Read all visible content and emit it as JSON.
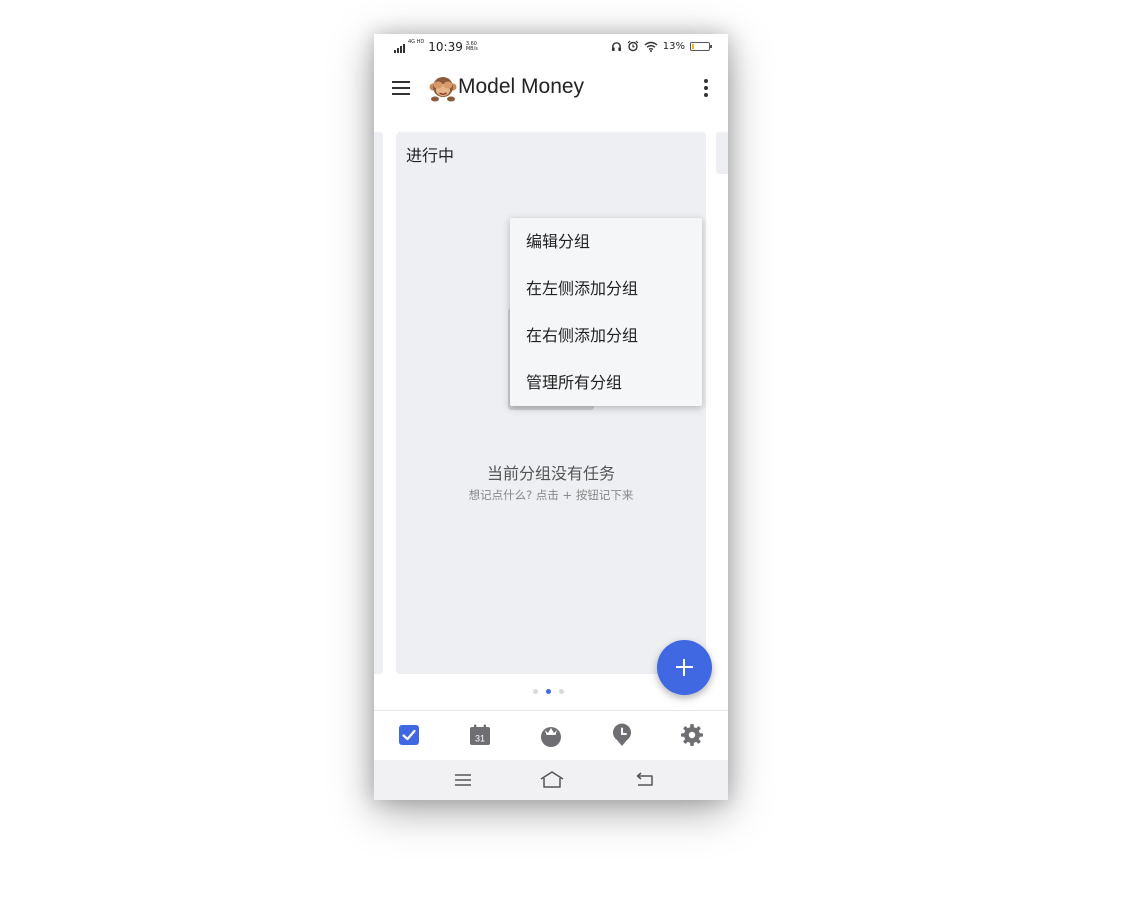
{
  "status_bar": {
    "network": "4G HD",
    "time": "10:39",
    "speed": "3.60 MB/s",
    "battery": "13%",
    "battery_level": 0.13,
    "battery_color": "#f2b418"
  },
  "app_bar": {
    "title": "Model Money",
    "logo_icon": "monkey-see-no-evil-icon",
    "menu_icon": "hamburger-icon",
    "more_icon": "more-vert-icon"
  },
  "group": {
    "title": "进行中",
    "empty_title": "当前分组没有任务",
    "empty_subtitle": "想记点什么? 点击 + 按钮记下来",
    "illustration_icon": "clipboard-pencil-icon"
  },
  "dropdown_menu": {
    "items": [
      "编辑分组",
      "在左侧添加分组",
      "在右侧添加分组",
      "管理所有分组"
    ]
  },
  "fab": {
    "icon": "plus-icon",
    "color": "#4168e3"
  },
  "pager": {
    "count": 3,
    "active_index": 1
  },
  "bottom_nav": {
    "items": [
      {
        "icon": "checkbox-icon",
        "active": true
      },
      {
        "icon": "calendar-icon",
        "label": "31",
        "active": false
      },
      {
        "icon": "tomato-icon",
        "active": false
      },
      {
        "icon": "clock-pin-icon",
        "active": false
      },
      {
        "icon": "gear-icon",
        "active": false
      }
    ],
    "active_color": "#4168e3",
    "inactive_color": "#6f6f73"
  },
  "system_nav": {
    "items": [
      "menu-icon",
      "home-icon",
      "back-icon"
    ]
  }
}
